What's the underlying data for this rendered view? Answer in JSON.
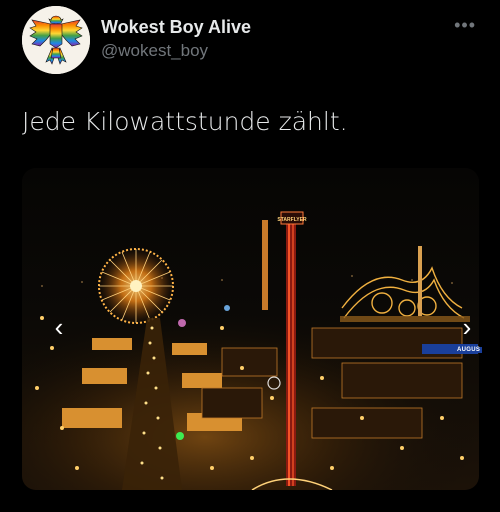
{
  "author": {
    "display_name": "Wokest Boy Alive",
    "handle": "@wokest_boy",
    "avatar_icon": "rainbow-eagle-icon"
  },
  "more_icon": "more-options-icon",
  "more_glyph": "•••",
  "tweet": {
    "text": "Jede Kilowattstunde zählt."
  },
  "media": {
    "alt": "Oktoberfest at night with illuminated rides",
    "signs": {
      "tower": "STARFLYER",
      "augustiner": "AUGUS"
    },
    "prev_glyph": "‹",
    "next_glyph": "›"
  },
  "colors": {
    "background": "#000000",
    "text": "#e7e9ea",
    "secondary": "#71767b"
  }
}
